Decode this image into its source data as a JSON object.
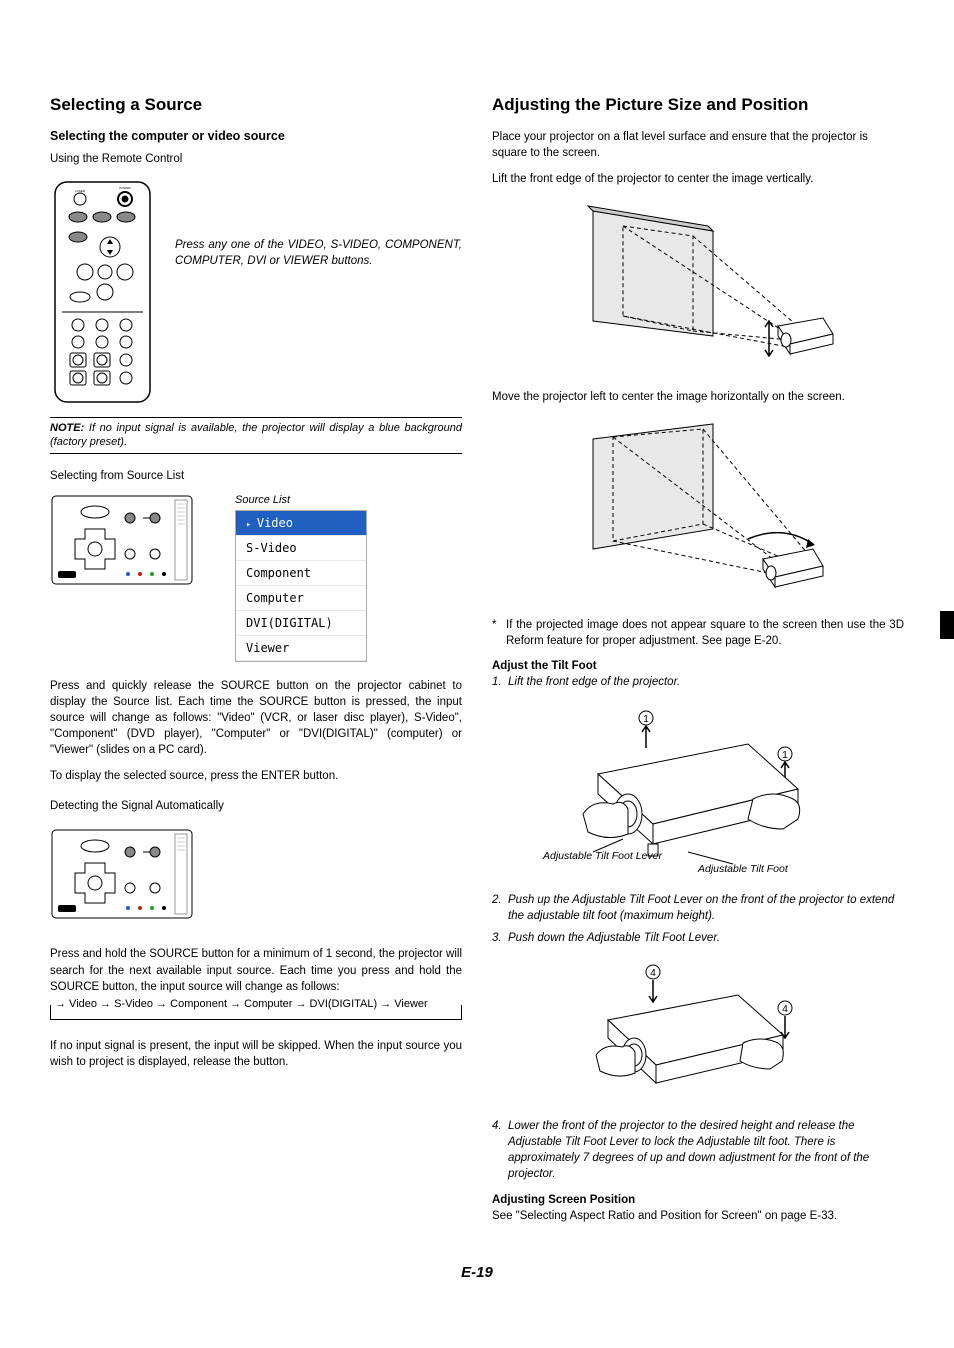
{
  "left": {
    "h2": "Selecting a Source",
    "h3": "Selecting the computer or video source",
    "using_remote": "Using the Remote Control",
    "remote_caption": "Press any one of the VIDEO, S-VIDEO, COMPONENT, COMPUTER, DVI or VIEWER buttons.",
    "note": "If no input signal is available, the projector will display a blue background (factory preset).",
    "note_prefix": "NOTE:",
    "selecting_from": "Selecting from Source List",
    "source_list_label": "Source List",
    "source_items": [
      "Video",
      "S-Video",
      "Component",
      "Computer",
      "DVI(DIGITAL)",
      "Viewer"
    ],
    "press_source": "Press and quickly release the SOURCE button on the projector cabinet to display the Source list. Each time the SOURCE button is pressed, the input source will change as follows: \"Video\" (VCR, or laser disc player), S-Video\", \"Component\" (DVD player), \"Computer\" or \"DVI(DIGITAL)\" (computer) or \"Viewer\" (slides on a PC card).",
    "to_display": "To display the selected source, press the ENTER button.",
    "detecting": "Detecting the Signal Automatically",
    "press_hold": "Press and hold the SOURCE button for a minimum of 1 second, the projector will search for the next available input source. Each time you press and hold the SOURCE button, the input source will change as follows:",
    "loop": "→ Video → S-Video → Component → Computer → DVI(DIGITAL) → Viewer",
    "if_no_input": "If no input signal is present, the input will be skipped. When the input source you wish to project is displayed, release the button."
  },
  "right": {
    "h2": "Adjusting the Picture Size and Position",
    "place": "Place your projector on a flat level surface and ensure that the projector is square to the screen.",
    "lift_front": "Lift the front edge of the projector to center the image vertically.",
    "move_left": "Move the projector left to center the image horizontally on the screen.",
    "asterisk": "If the projected image does not appear square to the screen then use the 3D Reform feature for proper adjustment. See page E-20.",
    "adjust_tilt": "Adjust the Tilt Foot",
    "step1": "Lift the front edge of the projector.",
    "label_lever": "Adjustable Tilt Foot Lever",
    "label_foot": "Adjustable Tilt Foot",
    "step2": "Push up the Adjustable Tilt Foot Lever on the front of the projector to extend the adjustable tilt foot (maximum height).",
    "step3": "Push down the Adjustable Tilt Foot Lever.",
    "step4": "Lower the front of the projector to the desired height and release the Adjustable Tilt Foot Lever to lock the Adjustable tilt foot. There is approximately 7 degrees of up and down adjustment for the front of the projector.",
    "adj_screen": "Adjusting Screen Position",
    "see_aspect": "See \"Selecting Aspect Ratio and Position for Screen\" on page E-33."
  },
  "page_number": "E-19"
}
